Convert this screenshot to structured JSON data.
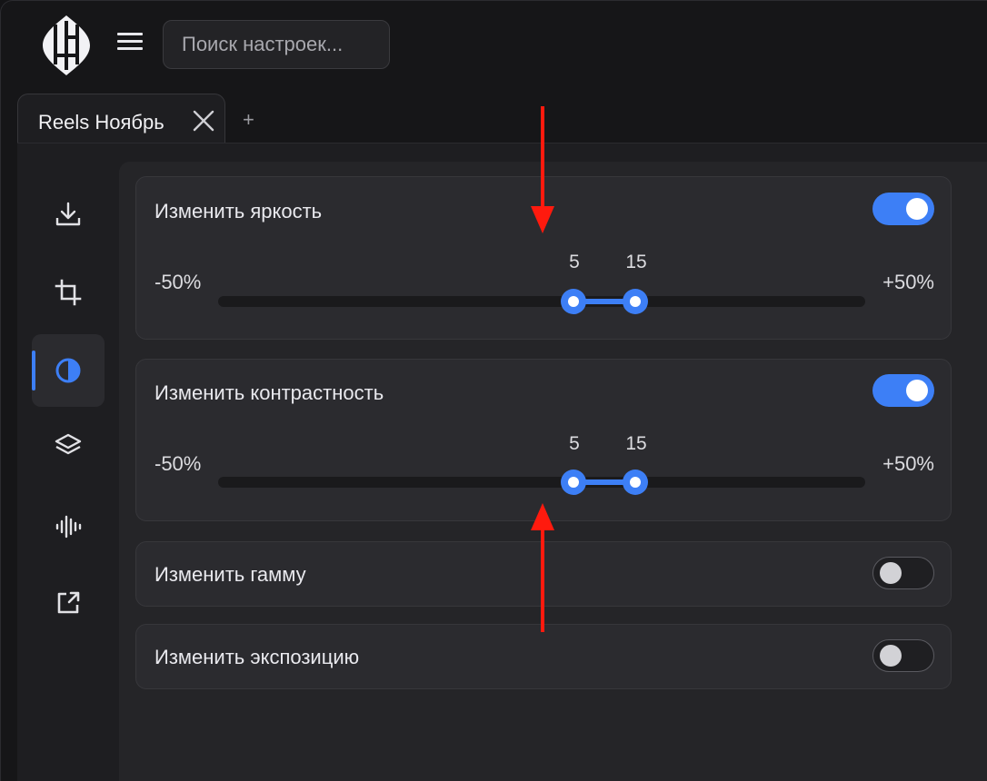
{
  "search": {
    "placeholder": "Поиск настроек..."
  },
  "tabs": [
    {
      "label": "Reels Ноябрь"
    }
  ],
  "sidebar": {
    "items": [
      {
        "icon": "download-icon"
      },
      {
        "icon": "crop-icon"
      },
      {
        "icon": "contrast-icon",
        "active": true
      },
      {
        "icon": "layers-icon"
      },
      {
        "icon": "audio-waveform-icon"
      },
      {
        "icon": "external-link-icon"
      }
    ]
  },
  "settings": {
    "brightness": {
      "label": "Изменить яркость",
      "enabled": true,
      "range_min": "-50%",
      "range_max": "+50%",
      "low": "5",
      "high": "15"
    },
    "contrast": {
      "label": "Изменить контрастность",
      "enabled": true,
      "range_min": "-50%",
      "range_max": "+50%",
      "low": "5",
      "high": "15"
    },
    "gamma": {
      "label": "Изменить гамму",
      "enabled": false
    },
    "exposure": {
      "label": "Изменить экспозицию",
      "enabled": false
    }
  },
  "colors": {
    "accent": "#3d7ff6",
    "annotation_arrow": "#ff1a0e",
    "background": "#161618",
    "card": "#2b2b2f"
  }
}
